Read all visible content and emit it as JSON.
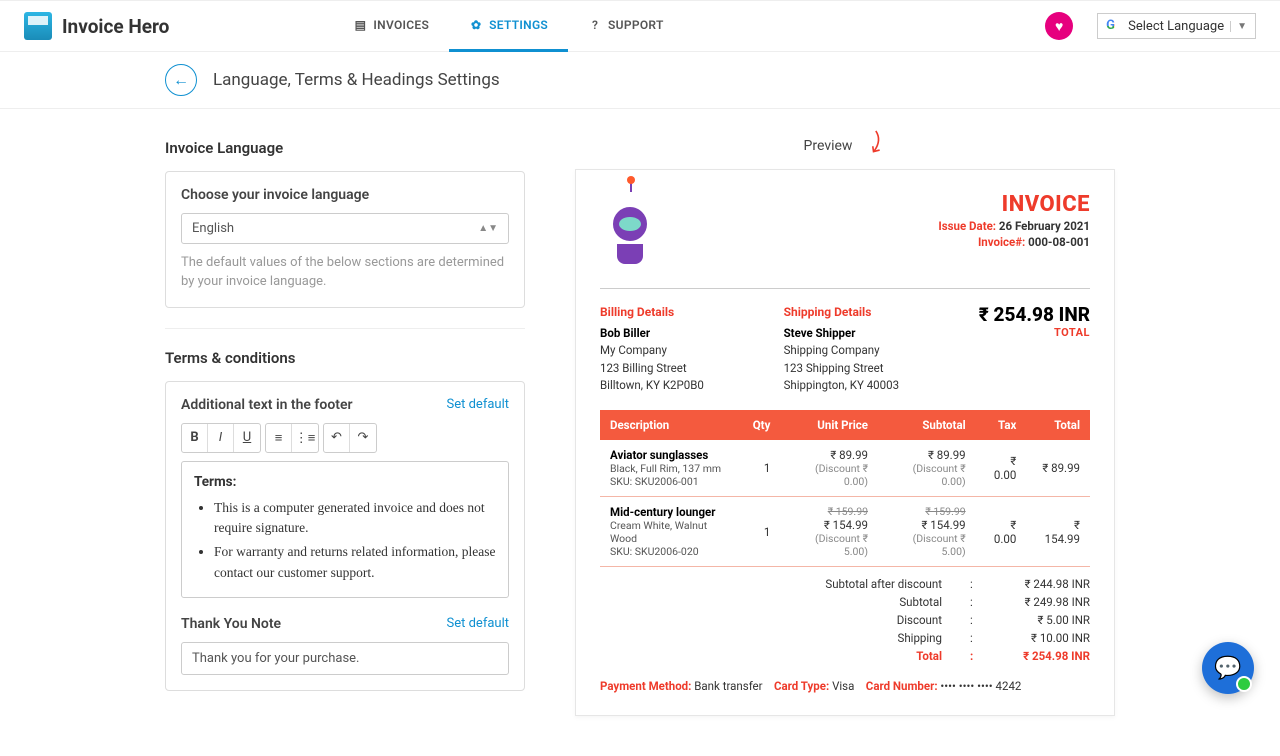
{
  "app": {
    "name": "Invoice Hero"
  },
  "nav": {
    "invoices": "INVOICES",
    "settings": "SETTINGS",
    "support": "SUPPORT"
  },
  "lang_picker": "Select Language",
  "page": {
    "title": "Language, Terms & Headings Settings"
  },
  "left": {
    "section_language": "Invoice Language",
    "choose_label": "Choose your invoice language",
    "language_value": "English",
    "helper": "The default values of the below sections are determined by your invoice language.",
    "section_terms": "Terms & conditions",
    "footer_label": "Additional text in the footer",
    "set_default": "Set default",
    "terms_heading": "Terms:",
    "terms_li1": "This is a computer generated invoice and does not require signature.",
    "terms_li2": "For warranty and returns related information, please contact our customer support.",
    "thank_label": "Thank You Note",
    "thank_value": "Thank you for your purchase."
  },
  "preview_label": "Preview",
  "invoice": {
    "title": "INVOICE",
    "issue_lbl": "Issue Date:",
    "issue_val": "26 February 2021",
    "num_lbl": "Invoice#:",
    "num_val": "000-08-001",
    "billing_title": "Billing Details",
    "billing_name": "Bob Biller",
    "billing_co": "My Company",
    "billing_addr": "123 Billing Street",
    "billing_city": "Billtown, KY K2P0B0",
    "shipping_title": "Shipping Details",
    "shipping_name": "Steve Shipper",
    "shipping_co": "Shipping Company",
    "shipping_addr": "123 Shipping Street",
    "shipping_city": "Shippington, KY 40003",
    "total_amount": "₹ 254.98 INR",
    "total_label": "TOTAL",
    "th_desc": "Description",
    "th_qty": "Qty",
    "th_unit": "Unit Price",
    "th_sub": "Subtotal",
    "th_tax": "Tax",
    "th_total": "Total",
    "i1_name": "Aviator sunglasses",
    "i1_variant": "Black, Full Rim, 137 mm",
    "i1_sku": "SKU: SKU2006-001",
    "i1_qty": "1",
    "i1_unit": "₹ 89.99",
    "i1_udisc": "(Discount ₹ 0.00)",
    "i1_sub": "₹ 89.99",
    "i1_sdisc": "(Discount ₹ 0.00)",
    "i1_tax": "₹ 0.00",
    "i1_total": "₹ 89.99",
    "i2_name": "Mid-century lounger",
    "i2_variant": "Cream White, Walnut Wood",
    "i2_sku": "SKU: SKU2006-020",
    "i2_qty": "1",
    "i2_strike": "₹ 159.99",
    "i2_unit": "₹ 154.99",
    "i2_udisc": "(Discount ₹ 5.00)",
    "i2_sub": "₹ 154.99",
    "i2_sdisc": "(Discount ₹ 5.00)",
    "i2_tax": "₹ 0.00",
    "i2_total": "₹ 154.99",
    "s1_lbl": "Subtotal after discount",
    "s1_val": "₹ 244.98 INR",
    "s2_lbl": "Subtotal",
    "s2_val": "₹ 249.98 INR",
    "s3_lbl": "Discount",
    "s3_val": "₹ 5.00 INR",
    "s4_lbl": "Shipping",
    "s4_val": "₹ 10.00 INR",
    "s5_lbl": "Total",
    "s5_val": "₹ 254.98 INR",
    "pm_lbl": "Payment Method:",
    "pm_val": "Bank transfer",
    "ct_lbl": "Card Type:",
    "ct_val": "Visa",
    "cn_lbl": "Card Number:",
    "cn_val": "•••• •••• •••• 4242"
  }
}
